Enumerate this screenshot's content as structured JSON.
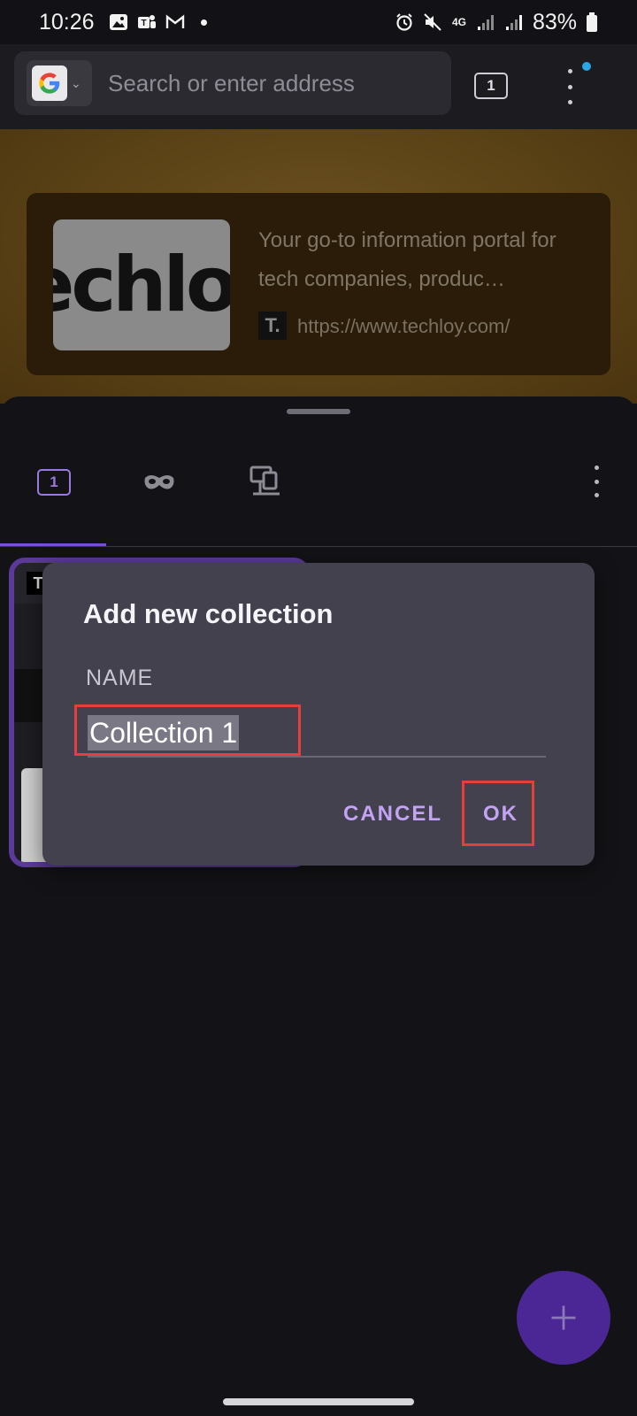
{
  "status_bar": {
    "time": "10:26",
    "battery": "83%",
    "network": "4G"
  },
  "browser": {
    "search_placeholder": "Search or enter address",
    "tab_count": "1"
  },
  "web_page": {
    "link_card": {
      "thumbnail_text": "echlo",
      "description": "Your go-to information portal for tech companies, produc…",
      "favicon_letter": "T.",
      "url": "https://www.techloy.com/"
    }
  },
  "tabs_tray": {
    "normal_tabs_count": "1"
  },
  "dialog": {
    "title": "Add new collection",
    "name_label": "NAME",
    "name_value": "Collection 1",
    "cancel_label": "CANCEL",
    "ok_label": "OK"
  },
  "colors": {
    "accent": "#c2a3f4",
    "tab_indicator": "#7a4fd8",
    "highlight": "#e3403d",
    "fab": "#4a2794"
  }
}
